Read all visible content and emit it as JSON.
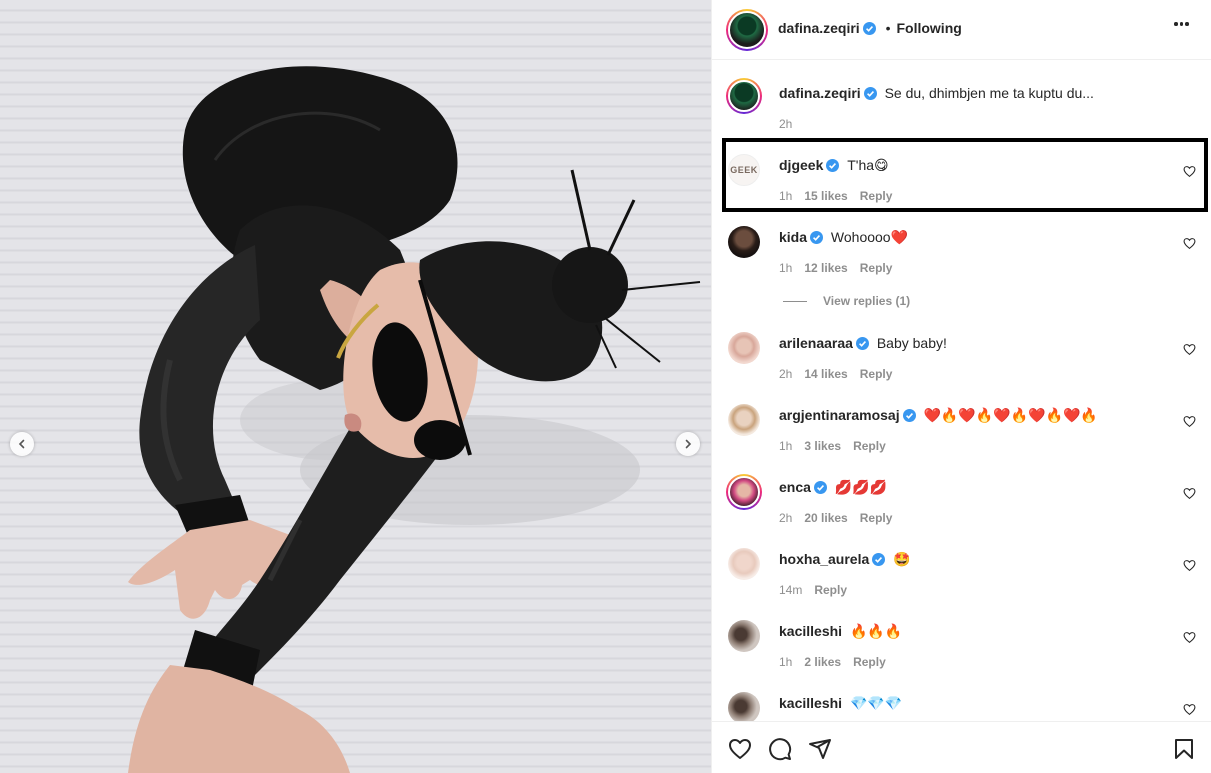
{
  "header": {
    "username": "dafina.zeqiri",
    "separator": "•",
    "follow_status": "Following"
  },
  "caption": {
    "username": "dafina.zeqiri",
    "text": "Se du, dhimbjen me ta kuptu du...",
    "time": "2h"
  },
  "comments": [
    {
      "username": "djgeek",
      "text": "T'ha😋",
      "time": "1h",
      "likes": "15 likes",
      "reply": "Reply",
      "avatar_text": "GEEK"
    },
    {
      "username": "kida",
      "text": "Wohoooo❤️",
      "time": "1h",
      "likes": "12 likes",
      "reply": "Reply"
    },
    {
      "username": "arilenaaraa",
      "text": "Baby baby!",
      "time": "2h",
      "likes": "14 likes",
      "reply": "Reply"
    },
    {
      "username": "argjentinaramosaj",
      "text": "❤️🔥❤️🔥❤️🔥❤️🔥❤️🔥",
      "time": "1h",
      "likes": "3 likes",
      "reply": "Reply"
    },
    {
      "username": "enca",
      "text": "💋💋💋",
      "time": "2h",
      "likes": "20 likes",
      "reply": "Reply"
    },
    {
      "username": "hoxha_aurela",
      "text": "🤩",
      "time": "14m",
      "likes": "",
      "reply": "Reply"
    },
    {
      "username": "kacilleshi",
      "text": "🔥🔥🔥",
      "time": "1h",
      "likes": "2 likes",
      "reply": "Reply"
    },
    {
      "username": "kacilleshi",
      "text": "💎💎💎",
      "time": "",
      "likes": "",
      "reply": ""
    }
  ],
  "view_replies": "View replies (1)",
  "icons": {
    "like": "heart-icon",
    "comment": "comment-icon",
    "share": "share-icon",
    "save": "bookmark-icon",
    "verified": "verified-badge-icon",
    "more": "more-options-icon",
    "prev": "chevron-left-icon",
    "next": "chevron-right-icon"
  },
  "colors": {
    "verified": "#3897f0",
    "text": "#262626",
    "secondary": "#8e8e8e",
    "border": "#efefef",
    "highlight_box": "#000000"
  }
}
